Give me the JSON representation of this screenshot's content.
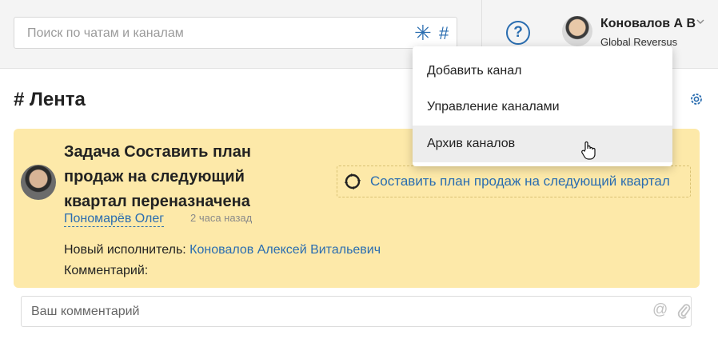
{
  "search": {
    "placeholder": "Поиск по чатам и каналам",
    "all_icon": "asterisk-icon",
    "channel_icon": "hash-icon"
  },
  "header": {
    "help_label": "?",
    "user_name": "Коновалов А В",
    "user_org": "Global Reversus"
  },
  "feed": {
    "title": "# Лента"
  },
  "post": {
    "title": "Задача Составить план продаж на следующий квартал переназначена",
    "author": "Пономарёв Олег",
    "time": "2 часа назад",
    "task_link": "Составить план продаж на следующий квартал",
    "new_assignee_label": "Новый исполнитель: ",
    "new_assignee": "Коновалов Алексей Витальевич",
    "comment_label": "Комментарий:"
  },
  "comment_box": {
    "placeholder": "Ваш комментарий",
    "mention_label": "@"
  },
  "dropdown": {
    "items": [
      {
        "label": "Добавить канал"
      },
      {
        "label": "Управление каналами"
      },
      {
        "label": "Архив каналов",
        "hovered": true
      }
    ]
  },
  "colors": {
    "accent": "#2a6db0",
    "card_bg": "#fde9a9",
    "topbar_bg": "#f4f4f4"
  }
}
